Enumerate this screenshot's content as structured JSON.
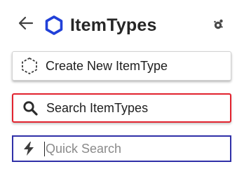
{
  "header": {
    "title": "ItemTypes",
    "back_icon": "arrow-left-icon",
    "type_icon": "hexagon-icon",
    "settings_icon": "cog-icon"
  },
  "actions": {
    "create_label": "Create New ItemType",
    "create_icon": "dashed-hexagon-icon",
    "search_label": "Search ItemTypes",
    "search_icon": "search-icon"
  },
  "quick_search": {
    "placeholder": "Quick Search",
    "value": "",
    "icon": "bolt-icon"
  },
  "colors": {
    "accent": "#2140d8",
    "search_border": "#e2232f",
    "quick_border": "#3030a8"
  }
}
